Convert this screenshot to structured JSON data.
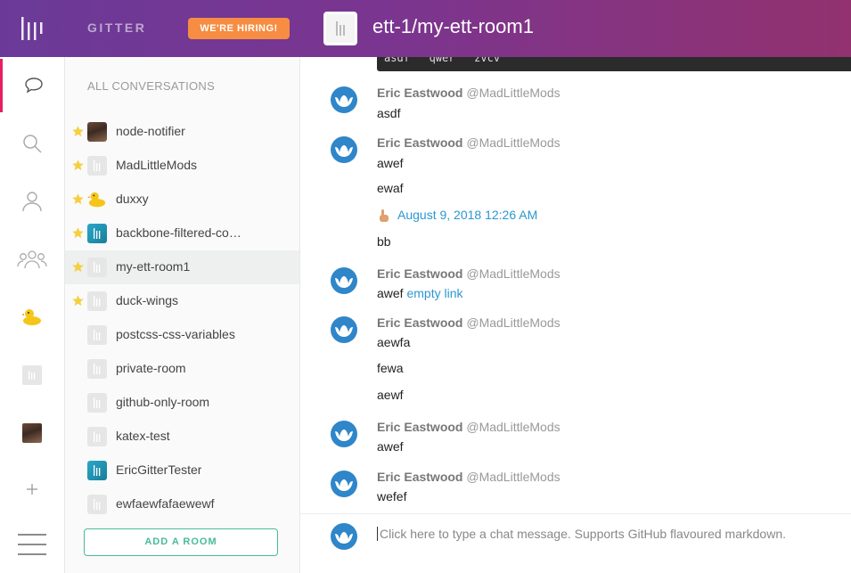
{
  "header": {
    "brand": "GITTER",
    "hiring_label": "WE'RE HIRING!",
    "room_title": "ett-1/my-ett-room1"
  },
  "rail": {
    "items": [
      "chat-icon",
      "search-icon",
      "person-icon",
      "people-icon",
      "duck-icon",
      "gitter-icon",
      "user-photo-icon",
      "plus-icon",
      "menu-icon"
    ]
  },
  "conversations": {
    "heading": "ALL CONVERSATIONS",
    "items": [
      {
        "label": "node-notifier",
        "starred": true,
        "avatar": "photo"
      },
      {
        "label": "MadLittleMods",
        "starred": true,
        "avatar": "gray"
      },
      {
        "label": "duxxy",
        "starred": true,
        "avatar": "duck"
      },
      {
        "label": "backbone-filtered-co…",
        "starred": true,
        "avatar": "teal"
      },
      {
        "label": "my-ett-room1",
        "starred": true,
        "avatar": "gray",
        "active": true
      },
      {
        "label": "duck-wings",
        "starred": true,
        "avatar": "gray"
      },
      {
        "label": "postcss-css-variables",
        "starred": false,
        "avatar": "gray"
      },
      {
        "label": "private-room",
        "starred": false,
        "avatar": "gray"
      },
      {
        "label": "github-only-room",
        "starred": false,
        "avatar": "gray"
      },
      {
        "label": "katex-test",
        "starred": false,
        "avatar": "gray"
      },
      {
        "label": "EricGitterTester",
        "starred": false,
        "avatar": "teal"
      },
      {
        "label": "ewfaewfafaewewf",
        "starred": false,
        "avatar": "gray"
      }
    ],
    "add_room_label": "ADD A ROOM"
  },
  "chat": {
    "code_snippet": "asdf  ``qwer``  zvcv",
    "author_name": "Eric Eastwood",
    "author_handle": "@MadLittleMods",
    "messages": {
      "m1": [
        "asdf"
      ],
      "m2": [
        "awef",
        "ewaf"
      ],
      "timestamp": "August 9, 2018 12:26 AM",
      "m2b": "bb",
      "m3_text": "awef",
      "m3_link": "empty link",
      "m4": [
        "aewfa",
        "fewa",
        "aewf"
      ],
      "m5": [
        "awef"
      ],
      "m6": [
        "wefef"
      ]
    },
    "input_placeholder": "Click here to type a chat message. Supports GitHub flavoured markdown."
  },
  "colors": {
    "header_start": "#6b3a98",
    "header_end": "#92326f",
    "hiring": "#f68d42",
    "accent_green": "#46bc99",
    "link_blue": "#2b97d0",
    "active_rail": "#e91e63"
  }
}
